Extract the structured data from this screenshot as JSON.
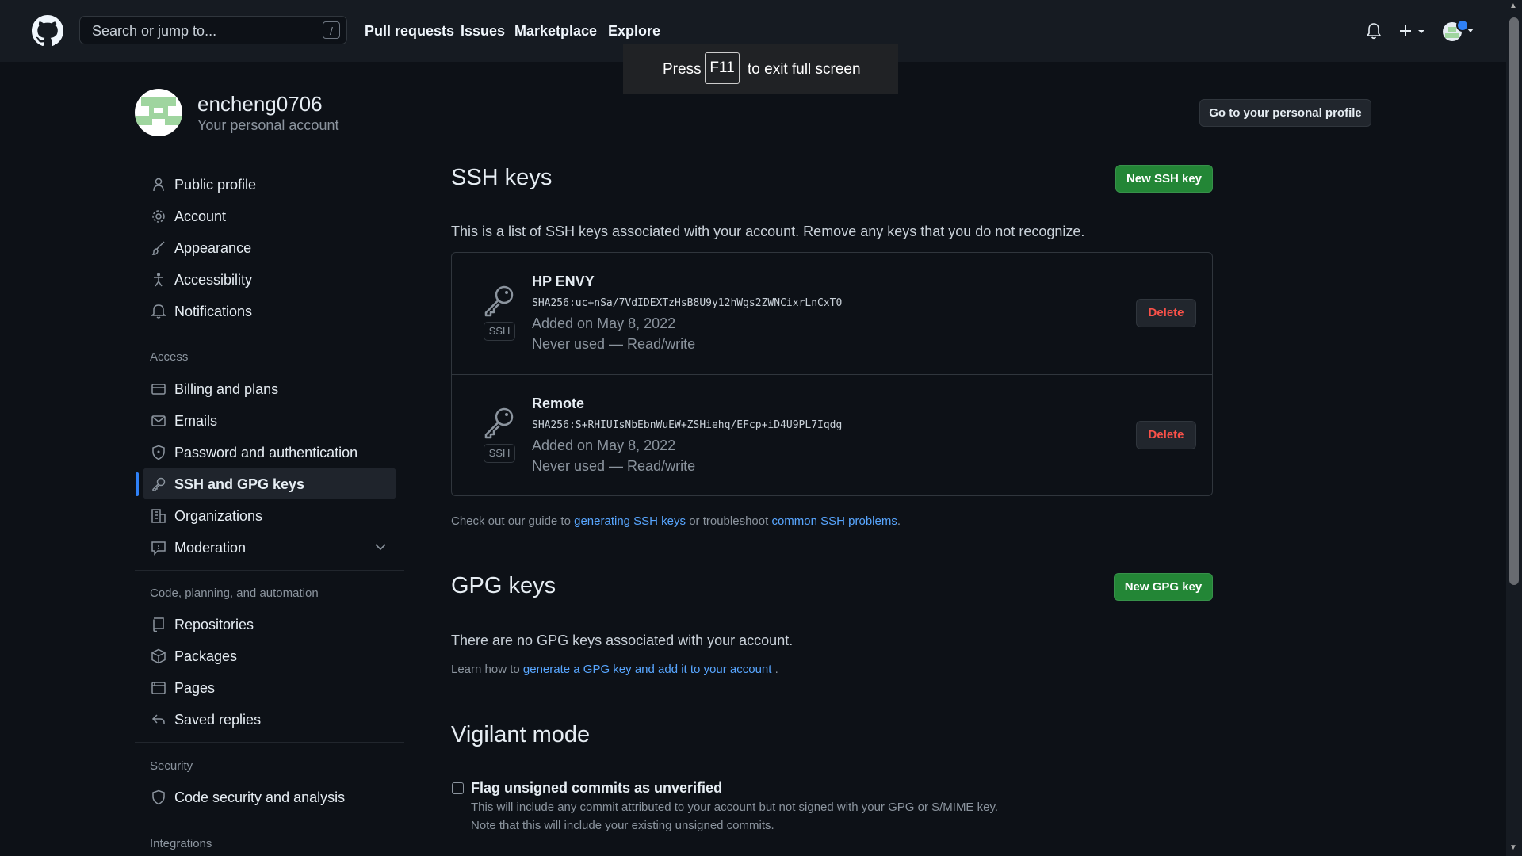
{
  "header": {
    "search_placeholder": "Search or jump to...",
    "search_shortcut": "/",
    "nav": [
      "Pull requests",
      "Issues",
      "Marketplace",
      "Explore"
    ]
  },
  "fullscreen_toast": {
    "press": "Press",
    "key": "F11",
    "rest": "to exit full screen"
  },
  "profile": {
    "username": "encheng0706",
    "subtitle": "Your personal account",
    "go_profile_button": "Go to your personal profile"
  },
  "sidebar": {
    "items": [
      {
        "label": "Public profile",
        "icon": "person-icon"
      },
      {
        "label": "Account",
        "icon": "gear-icon"
      },
      {
        "label": "Appearance",
        "icon": "paintbrush-icon"
      },
      {
        "label": "Accessibility",
        "icon": "accessibility-icon"
      },
      {
        "label": "Notifications",
        "icon": "bell-icon"
      }
    ],
    "access_heading": "Access",
    "access_items": [
      {
        "label": "Billing and plans",
        "icon": "credit-card-icon"
      },
      {
        "label": "Emails",
        "icon": "mail-icon"
      },
      {
        "label": "Password and authentication",
        "icon": "shield-lock-icon"
      },
      {
        "label": "SSH and GPG keys",
        "icon": "key-icon",
        "active": true
      },
      {
        "label": "Organizations",
        "icon": "organization-icon"
      },
      {
        "label": "Moderation",
        "icon": "report-icon"
      }
    ],
    "code_heading": "Code, planning, and automation",
    "code_items": [
      {
        "label": "Repositories",
        "icon": "repo-icon"
      },
      {
        "label": "Packages",
        "icon": "package-icon"
      },
      {
        "label": "Pages",
        "icon": "browser-icon"
      },
      {
        "label": "Saved replies",
        "icon": "reply-icon"
      }
    ],
    "security_heading": "Security",
    "security_items": [
      {
        "label": "Code security and analysis",
        "icon": "shield-icon"
      }
    ],
    "integrations_heading": "Integrations"
  },
  "ssh": {
    "title": "SSH keys",
    "new_button": "New SSH key",
    "description": "This is a list of SSH keys associated with your account. Remove any keys that you do not recognize.",
    "keys": [
      {
        "name": "HP ENVY",
        "fingerprint": "SHA256:uc+nSa/7VdIDEXTzHsB8U9y12hWgs2ZWNCixrLnCxT0",
        "added": "Added on May 8, 2022",
        "usage": "Never used — Read/write",
        "tag": "SSH",
        "delete_label": "Delete"
      },
      {
        "name": "Remote",
        "fingerprint": "SHA256:S+RHIUIsNbEbnWuEW+ZSHiehq/EFcp+iD4U9PL7Iqdg",
        "added": "Added on May 8, 2022",
        "usage": "Never used — Read/write",
        "tag": "SSH",
        "delete_label": "Delete"
      }
    ],
    "guide_prefix": "Check out our guide to",
    "guide_link1": "generating SSH keys",
    "guide_mid": "or troubleshoot",
    "guide_link2": "common SSH problems",
    "guide_suffix": "."
  },
  "gpg": {
    "title": "GPG keys",
    "new_button": "New GPG key",
    "empty": "There are no GPG keys associated with your account.",
    "learn_prefix": "Learn how to",
    "learn_link": "generate a GPG key and add it to your account",
    "learn_suffix": "."
  },
  "vigilant": {
    "title": "Vigilant mode",
    "checkbox_label": "Flag unsigned commits as unverified",
    "note1": "This will include any commit attributed to your account but not signed with your GPG or S/MIME key.",
    "note2": "Note that this will include your existing unsigned commits."
  }
}
